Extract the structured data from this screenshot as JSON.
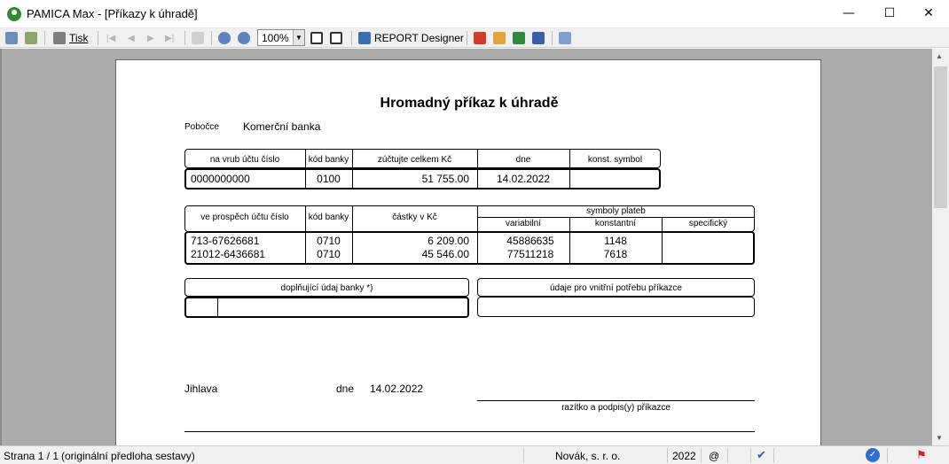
{
  "window": {
    "title": "PAMICA Max - [Příkazy k úhradě]",
    "minimize": "—",
    "maximize": "☐",
    "close": "✕"
  },
  "toolbar": {
    "print_label": "Tisk",
    "zoom_value": "100%",
    "report_designer_label": "REPORT Designer",
    "icons": [
      "export-icon",
      "import-icon",
      "print-icon",
      "first-page-icon",
      "prev-page-icon",
      "next-page-icon",
      "last-page-icon",
      "page-view-icon",
      "zoom-in-icon",
      "zoom-out-icon",
      "fit-page-icon",
      "fit-width-icon",
      "report-designer-icon",
      "pdf-icon",
      "pdf-edit-icon",
      "excel-icon",
      "word-icon",
      "help-icon"
    ]
  },
  "document": {
    "title": "Hromadný příkaz k úhradě",
    "branch_label": "Pobočce",
    "branch_value": "Komerční banka",
    "debit": {
      "headers": [
        "na vrub účtu číslo",
        "kód banky",
        "zúčtujte celkem Kč",
        "dne",
        "konst. symbol"
      ],
      "account": "0000000000",
      "bank_code": "0100",
      "total": "51 755.00",
      "date": "14.02.2022",
      "const_symbol": ""
    },
    "credit": {
      "headers": {
        "account": "ve prospěch účtu číslo",
        "bank_code": "kód banky",
        "amount": "částky v Kč",
        "symbols": "symboly plateb",
        "variable": "variabilní",
        "constant": "konstantní",
        "specific": "specifický"
      },
      "rows": [
        {
          "account": "713-67626681",
          "bank_code": "0710",
          "amount": "6 209.00",
          "variable": "45886635",
          "constant": "1148",
          "specific": ""
        },
        {
          "account": "21012-6436681",
          "bank_code": "0710",
          "amount": "45 546.00",
          "variable": "77511218",
          "constant": "7618",
          "specific": ""
        }
      ]
    },
    "bank_data_label": "doplňující údaj banky *)",
    "internal_label": "údaje pro vnitřní potřebu příkazce",
    "city": "Jihlava",
    "date_label": "dne",
    "date_value": "14.02.2022",
    "signature_label": "razítko a podpis(y) příkazce"
  },
  "status": {
    "page": "Strana 1 / 1",
    "template": "(originální předloha sestavy)",
    "company": "Novák, s. r. o.",
    "year": "2022",
    "at": "@"
  }
}
